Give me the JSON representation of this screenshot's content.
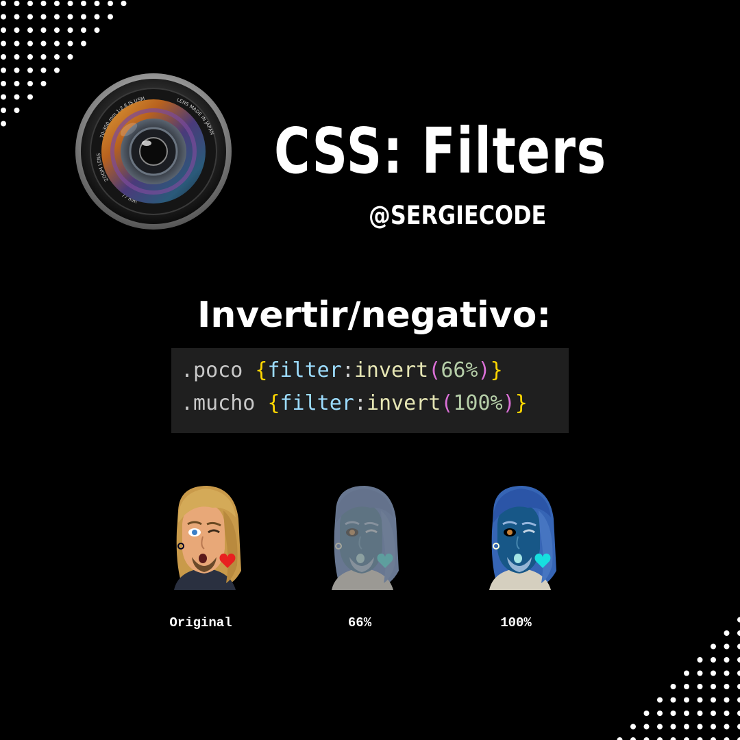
{
  "header": {
    "title": "CSS: Filters",
    "handle": "@SERGIECODE"
  },
  "section": {
    "subtitle": "Invertir/negativo:"
  },
  "code": {
    "line1": {
      "selector": ".poco ",
      "open": "{",
      "prop": "filter",
      "colon": ":",
      "fn": "invert",
      "paren_open": "(",
      "value": "66%",
      "paren_close": ")",
      "close": "}"
    },
    "line2": {
      "selector": ".mucho ",
      "open": "{",
      "prop": "filter",
      "colon": ":",
      "fn": "invert",
      "paren_open": "(",
      "value": "100%",
      "paren_close": ")",
      "close": "}"
    }
  },
  "examples": [
    {
      "caption": "Original",
      "invert": 0
    },
    {
      "caption": "66%",
      "invert": 0.66
    },
    {
      "caption": "100%",
      "invert": 1
    }
  ],
  "lens": {
    "ring_top": "70-300 mm     1:2.8      IS   USM",
    "ring_left": "ZOOM LENS",
    "ring_right": "LENS MADE IN JAPAN",
    "ring_bottom": "77 mm"
  },
  "colors": {
    "background": "#000000",
    "code_background": "#1f1f1f",
    "text": "#ffffff"
  }
}
